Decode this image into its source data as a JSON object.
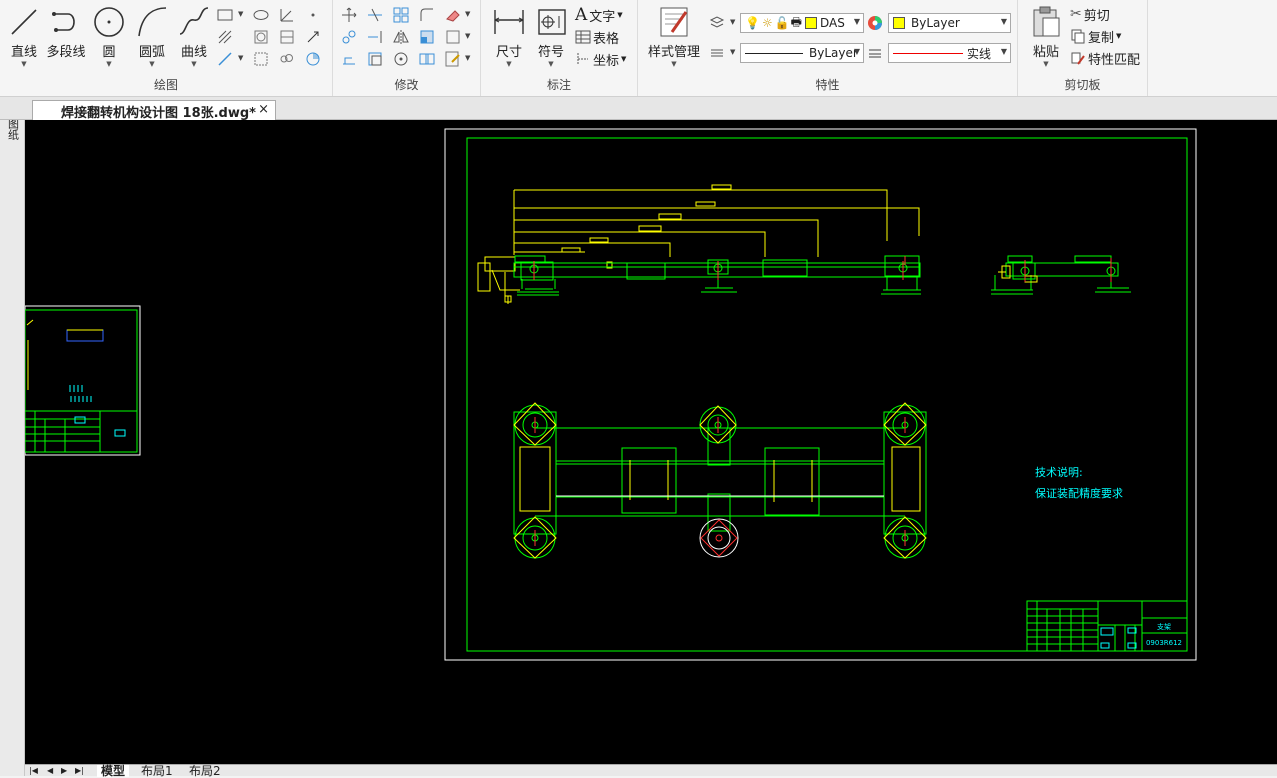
{
  "ribbon": {
    "draw_panel": {
      "title": "绘图",
      "line": "直线",
      "polyline": "多段线",
      "circle": "圆",
      "arc": "圆弧",
      "spline": "曲线"
    },
    "modify_panel": {
      "title": "修改"
    },
    "annotate_panel": {
      "title": "标注",
      "dimension": "尺寸",
      "symbol": "符号",
      "text": "文字",
      "table": "表格",
      "coord": "坐标"
    },
    "props_panel": {
      "title": "特性",
      "style_mgr": "样式管理",
      "layer_name": "DAS",
      "color": "ByLayer",
      "linetype": "ByLayer",
      "lineweight": "实线"
    },
    "clipboard_panel": {
      "title": "剪切板",
      "paste": "粘贴",
      "cut": "剪切",
      "copy": "复制",
      "matchprop": "特性匹配"
    }
  },
  "doc_tab": {
    "filename": "焊接翻转机构设计图 18张.dwg*",
    "close": "×"
  },
  "sidebar": {
    "label": "图纸"
  },
  "drawing": {
    "tech_title": "技术说明:",
    "tech_text": "保证装配精度要求",
    "tb_name": "支架",
    "tb_number": "0903R612"
  },
  "layout_tabs": [
    "模型",
    "布局1",
    "布局2"
  ],
  "colors": {
    "green": "#00ff00",
    "yellow": "#ffff00",
    "cyan": "#00ffff",
    "white": "#ffffff",
    "red": "#ff3030",
    "blue": "#3b5bff"
  }
}
